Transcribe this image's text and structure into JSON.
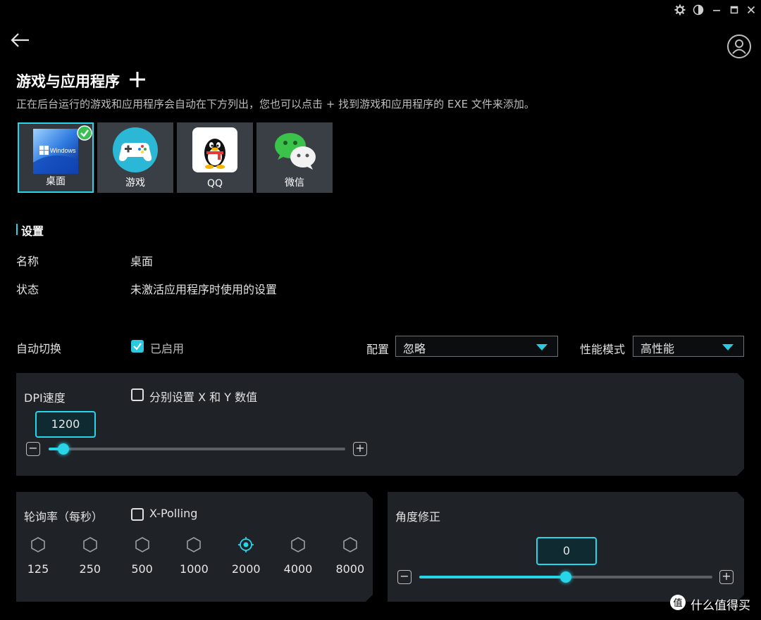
{
  "titlebar": {
    "icons": [
      "gear-icon",
      "theme-icon",
      "minimize-icon",
      "maximize-icon",
      "close-icon"
    ]
  },
  "header": {
    "title": "游戏与应用程序",
    "subtitle": "正在后台运行的游戏和应用程序会自动在下方列出，您也可以点击 + 找到游戏和应用程序的 EXE 文件来添加。"
  },
  "apps": [
    {
      "label": "桌面",
      "selected": true
    },
    {
      "label": "游戏",
      "selected": false
    },
    {
      "label": "QQ",
      "selected": false
    },
    {
      "label": "微信",
      "selected": false
    }
  ],
  "windows_tile_text": "Windows",
  "settings": {
    "section_title": "设置",
    "name_label": "名称",
    "name_value": "桌面",
    "status_label": "状态",
    "status_value": "未激活应用程序时使用的设置",
    "auto_switch_label": "自动切换",
    "auto_switch_checked": true,
    "auto_switch_value": "已启用",
    "profile_label": "配置",
    "profile_value": "忽略",
    "perf_label": "性能模式",
    "perf_value": "高性能"
  },
  "dpi": {
    "title": "DPI速度",
    "separate_xy_label": "分别设置 X 和 Y 数值",
    "separate_xy_checked": false,
    "value": "1200",
    "slider_fraction": 0.05
  },
  "polling": {
    "title": "轮询率（每秒）",
    "xpolling_label": "X-Polling",
    "xpolling_checked": false,
    "rates": [
      "125",
      "250",
      "500",
      "1000",
      "2000",
      "4000",
      "8000"
    ],
    "selected": "2000"
  },
  "angle": {
    "title": "角度修正",
    "value": "0",
    "slider_fraction": 0.5
  },
  "watermark": "什么值得买",
  "colors": {
    "accent": "#27d4e8",
    "background": "#000000",
    "panel": "#1f2226",
    "tile": "#3a3f45"
  }
}
